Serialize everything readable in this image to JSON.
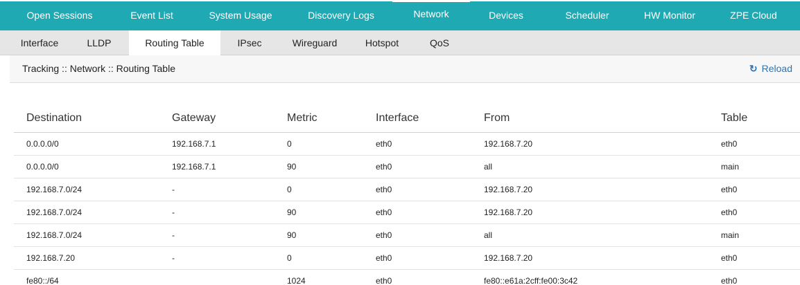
{
  "top_nav": {
    "items": [
      {
        "label": "Open Sessions"
      },
      {
        "label": "Event List"
      },
      {
        "label": "System Usage"
      },
      {
        "label": "Discovery Logs"
      },
      {
        "label": "Network"
      },
      {
        "label": "Devices"
      },
      {
        "label": "Scheduler"
      },
      {
        "label": "HW Monitor"
      },
      {
        "label": "ZPE Cloud"
      }
    ],
    "active": "Network",
    "color": "#1fa9b2"
  },
  "sub_nav": {
    "items": [
      {
        "label": "Interface"
      },
      {
        "label": "LLDP"
      },
      {
        "label": "Routing Table"
      },
      {
        "label": "IPsec"
      },
      {
        "label": "Wireguard"
      },
      {
        "label": "Hotspot"
      },
      {
        "label": "QoS"
      }
    ],
    "active": "Routing Table"
  },
  "breadcrumb": "Tracking :: Network :: Routing Table",
  "reload": {
    "label": "Reload",
    "icon": "refresh-icon",
    "color": "#2a74b8"
  },
  "table": {
    "columns": [
      "Destination",
      "Gateway",
      "Metric",
      "Interface",
      "From",
      "Table"
    ],
    "rows": [
      [
        "0.0.0.0/0",
        "192.168.7.1",
        "0",
        "eth0",
        "192.168.7.20",
        "eth0"
      ],
      [
        "0.0.0.0/0",
        "192.168.7.1",
        "90",
        "eth0",
        "all",
        "main"
      ],
      [
        "192.168.7.0/24",
        "-",
        "0",
        "eth0",
        "192.168.7.20",
        "eth0"
      ],
      [
        "192.168.7.0/24",
        "-",
        "90",
        "eth0",
        "192.168.7.20",
        "eth0"
      ],
      [
        "192.168.7.0/24",
        "-",
        "90",
        "eth0",
        "all",
        "main"
      ],
      [
        "192.168.7.20",
        "-",
        "0",
        "eth0",
        "192.168.7.20",
        "eth0"
      ],
      [
        "fe80::/64",
        "",
        "1024",
        "eth0",
        "fe80::e61a:2cff:fe00:3c42",
        "eth0"
      ]
    ]
  }
}
